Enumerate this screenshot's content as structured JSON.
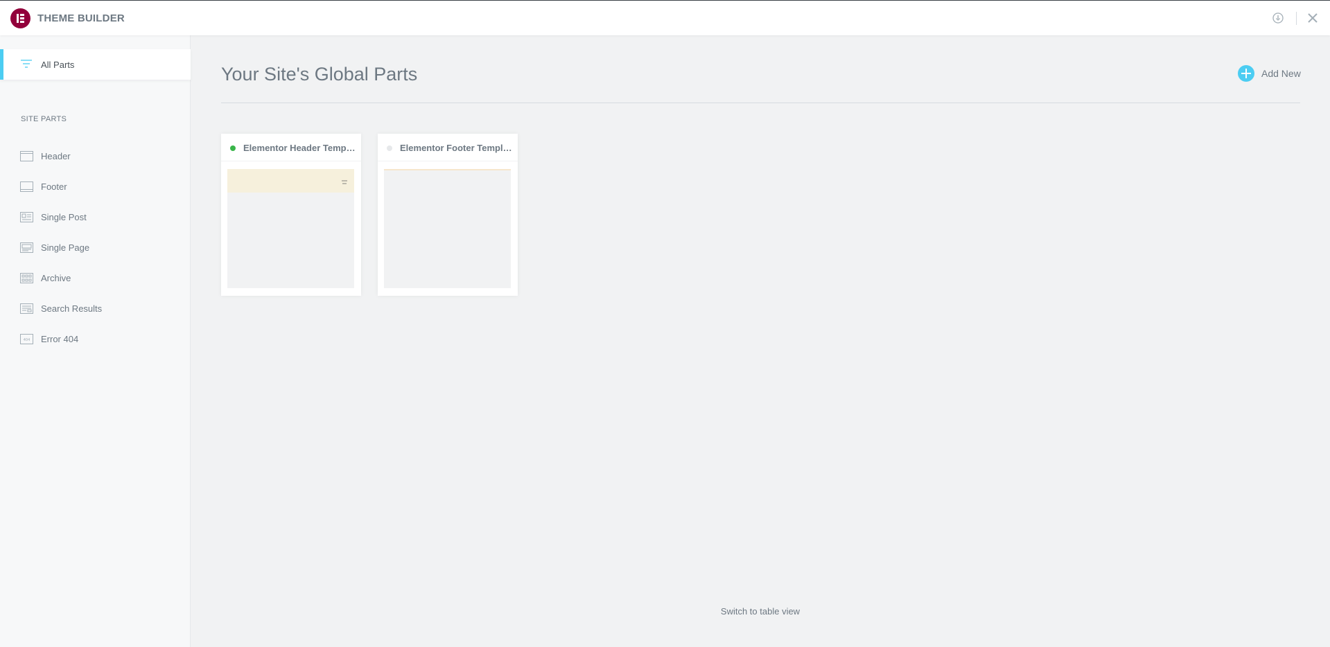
{
  "app": {
    "title": "THEME BUILDER"
  },
  "topbar": {
    "info_icon": "info-circle-icon",
    "close_icon": "close-icon"
  },
  "colors": {
    "brand": "#92003b",
    "accent": "#4ccdf2",
    "active_status": "#39b54a"
  },
  "sidebar": {
    "all_parts": {
      "label": "All Parts",
      "icon": "filter-lines-icon",
      "selected": true
    },
    "section_title": "SITE PARTS",
    "items": [
      {
        "label": "Header",
        "icon": "header-layout-icon"
      },
      {
        "label": "Footer",
        "icon": "footer-layout-icon"
      },
      {
        "label": "Single Post",
        "icon": "single-post-icon"
      },
      {
        "label": "Single Page",
        "icon": "single-page-icon"
      },
      {
        "label": "Archive",
        "icon": "archive-grid-icon"
      },
      {
        "label": "Search Results",
        "icon": "search-results-icon"
      },
      {
        "label": "Error 404",
        "icon": "error-404-icon"
      }
    ]
  },
  "main": {
    "page_title": "Your Site's Global Parts",
    "add_new_label": "Add New",
    "cards": [
      {
        "title": "Elementor Header Template",
        "status": "active"
      },
      {
        "title": "Elementor Footer Template",
        "status": "inactive"
      }
    ],
    "switch_view_label": "Switch to table view"
  }
}
